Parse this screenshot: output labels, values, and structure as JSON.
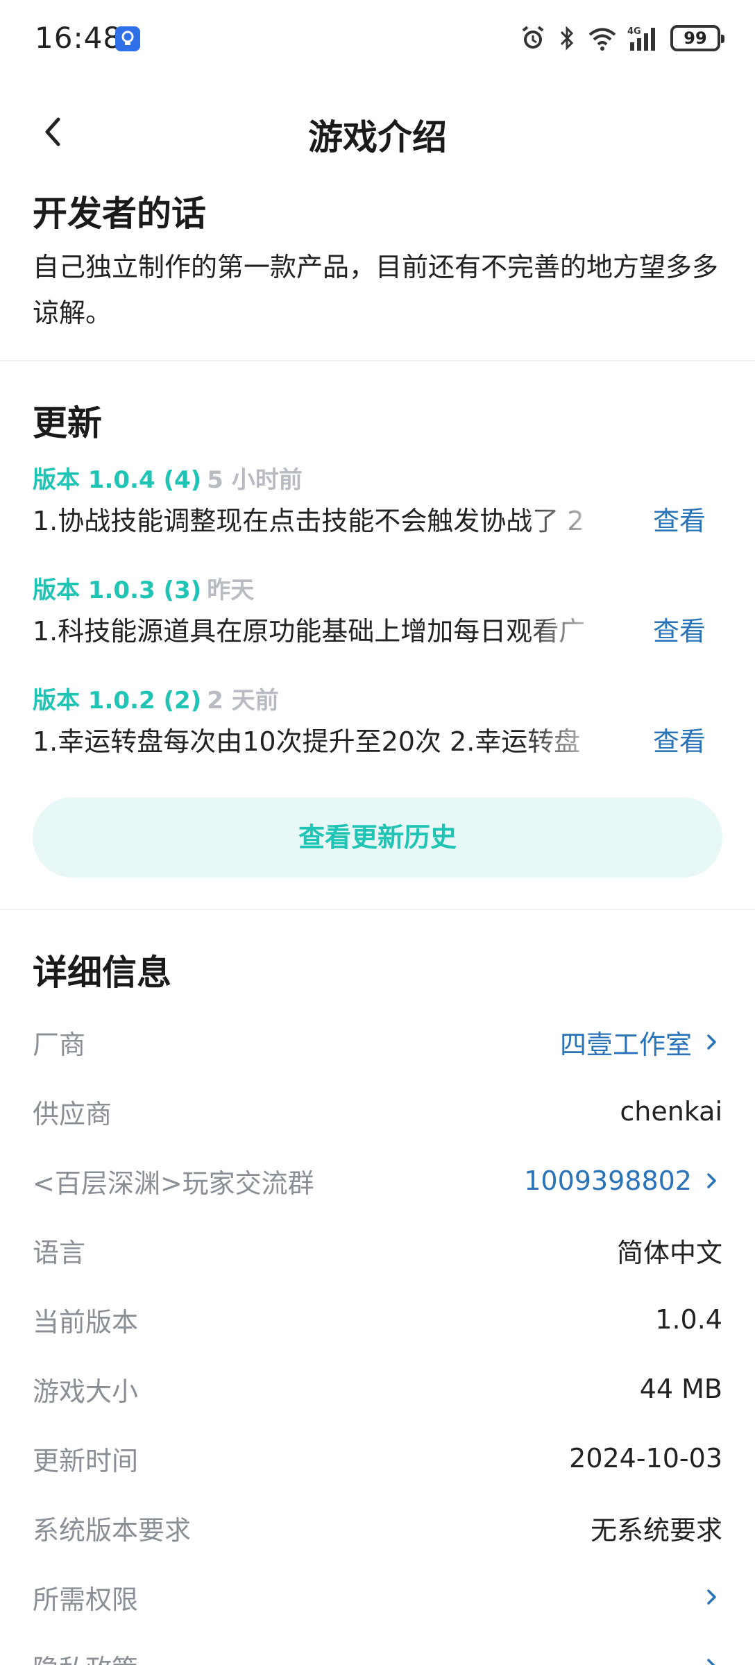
{
  "status_bar": {
    "time": "16:48",
    "battery": "99",
    "network": "4G",
    "icons": [
      "bulb-icon",
      "alarm-icon",
      "bluetooth-icon",
      "wifi-icon",
      "signal-icon",
      "battery-icon"
    ]
  },
  "nav": {
    "title": "游戏介绍",
    "back_icon": "chevron-left-icon"
  },
  "developer": {
    "heading": "开发者的话",
    "text": "自己独立制作的第一款产品，目前还有不完善的地方望多多谅解。"
  },
  "updates": {
    "heading": "更新",
    "items": [
      {
        "version": "版本 1.0.4 (4)",
        "ago": "5 小时前",
        "desc": "1.协战技能调整现在点击技能不会触发协战了 2",
        "action": "查看"
      },
      {
        "version": "版本 1.0.3 (3)",
        "ago": "昨天",
        "desc": "1.科技能源道具在原功能基础上增加每日观看广",
        "action": "查看"
      },
      {
        "version": "版本 1.0.2 (2)",
        "ago": "2 天前",
        "desc": "1.幸运转盘每次由10次提升至20次 2.幸运转盘",
        "action": "查看"
      }
    ],
    "history_button": "查看更新历史"
  },
  "details": {
    "heading": "详细信息",
    "rows": [
      {
        "label": "厂商",
        "value": "四壹工作室",
        "link": true
      },
      {
        "label": "供应商",
        "value": "chenkai",
        "link": false
      },
      {
        "label": "<百层深渊>玩家交流群",
        "value": "1009398802",
        "link": true
      },
      {
        "label": "语言",
        "value": "简体中文",
        "link": false
      },
      {
        "label": "当前版本",
        "value": "1.0.4",
        "link": false
      },
      {
        "label": "游戏大小",
        "value": "44 MB",
        "link": false
      },
      {
        "label": "更新时间",
        "value": "2024-10-03",
        "link": false
      },
      {
        "label": "系统版本要求",
        "value": "无系统要求",
        "link": false
      },
      {
        "label": "所需权限",
        "value": "",
        "link": true
      },
      {
        "label": "隐私政策",
        "value": "",
        "link": true
      }
    ]
  },
  "colors": {
    "accent_teal": "#1fc4b4",
    "link_blue": "#2a73b8",
    "muted_gray": "#8a8f96",
    "button_bg": "#e8f8f7"
  }
}
